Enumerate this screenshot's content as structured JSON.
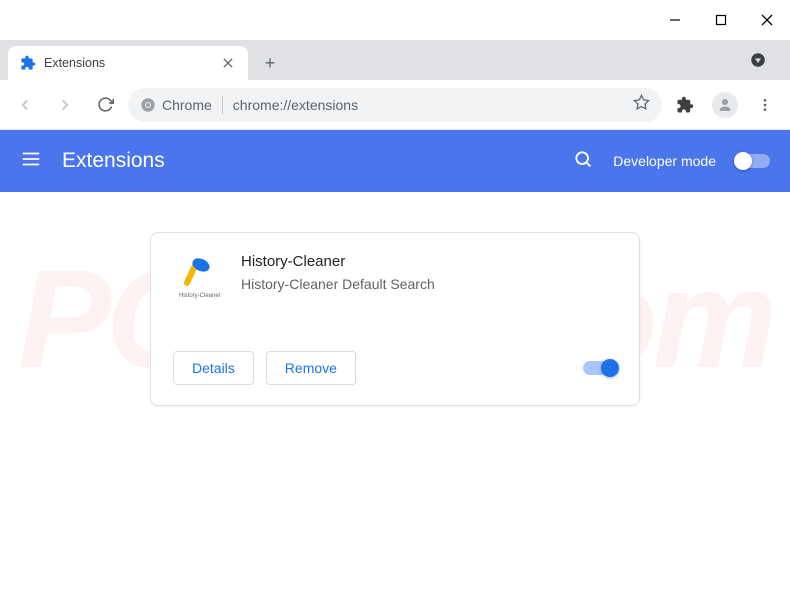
{
  "window": {
    "tab_title": "Extensions",
    "omnibox_prefix": "Chrome",
    "omnibox_url": "chrome://extensions"
  },
  "header": {
    "title": "Extensions",
    "dev_mode_label": "Developer mode",
    "dev_mode_enabled": false
  },
  "extension": {
    "name": "History-Cleaner",
    "description": "History-Cleaner Default Search",
    "details_label": "Details",
    "remove_label": "Remove",
    "enabled": true
  },
  "watermark": "PC risk.com"
}
